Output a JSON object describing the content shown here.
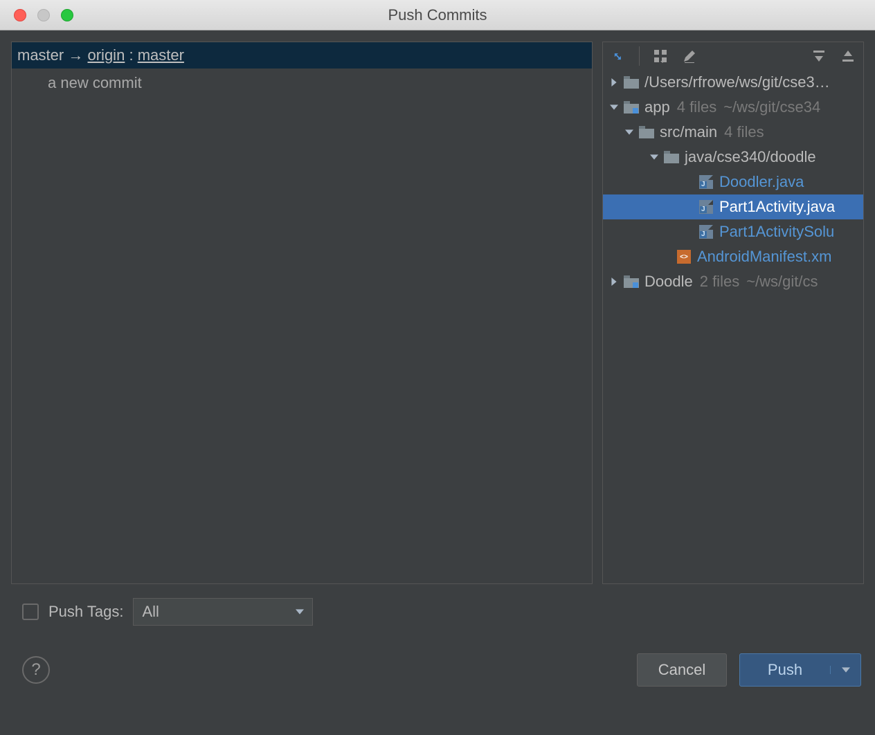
{
  "window": {
    "title": "Push Commits"
  },
  "push": {
    "local_branch": "master",
    "arrow": "→",
    "remote": "origin",
    "colon": ":",
    "remote_branch": "master",
    "commit_message": "a new commit"
  },
  "tree": {
    "root": {
      "label": "/Users/rfrowe/ws/git/cse3…"
    },
    "app": {
      "label": "app",
      "meta": "4 files",
      "path": "~/ws/git/cse34"
    },
    "src": {
      "label": "src/main",
      "meta": "4 files"
    },
    "pkg": {
      "label": "java/cse340/doodle"
    },
    "files": {
      "doodler": "Doodler.java",
      "part1": "Part1Activity.java",
      "part1sol": "Part1ActivitySolu",
      "manifest": "AndroidManifest.xm"
    },
    "doodle": {
      "label": "Doodle",
      "meta": "2 files",
      "path": "~/ws/git/cs"
    }
  },
  "tags": {
    "checkbox_label": "Push Tags:",
    "select_value": "All"
  },
  "buttons": {
    "help": "?",
    "cancel": "Cancel",
    "push": "Push"
  }
}
